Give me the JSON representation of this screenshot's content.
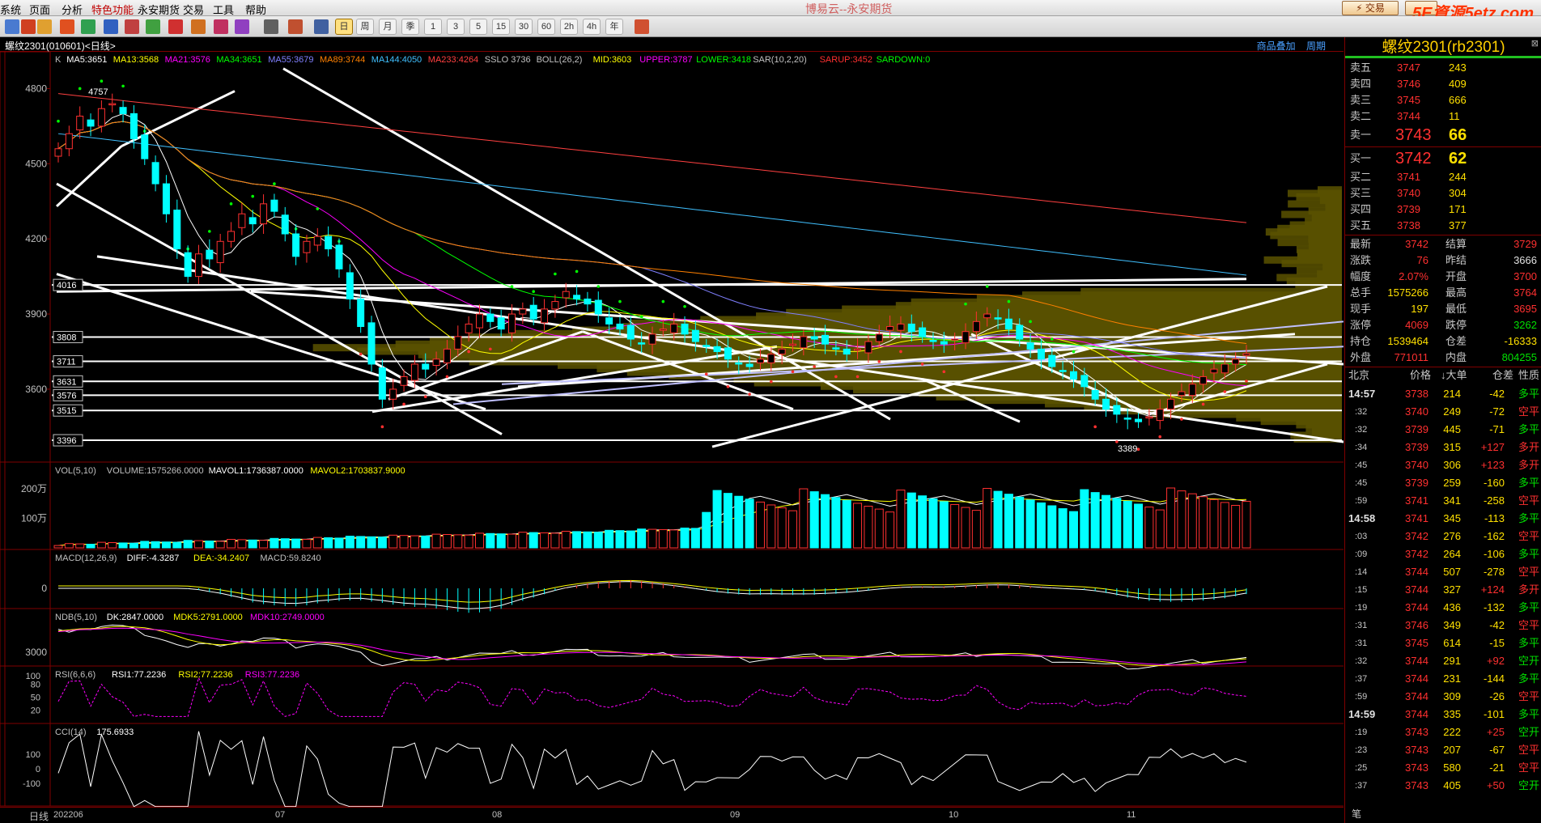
{
  "menu": {
    "items": [
      "系统",
      "页面",
      "分析",
      "特色功能",
      "永安期货",
      "交易",
      "工具",
      "帮助"
    ],
    "app_title": "博易云--永安期货",
    "trade_button": "⚡ 交易",
    "watermark": "5E資源5etz.com"
  },
  "toolbar": {
    "periods": [
      "日",
      "周",
      "月",
      "季",
      "1",
      "3",
      "5",
      "15",
      "30",
      "60",
      "2h",
      "4h",
      "年"
    ]
  },
  "chart": {
    "symbol_title": "螺纹2301(010601)<日线>",
    "link_overlay": "商品叠加",
    "link_period": "周期",
    "main_legend": [
      {
        "text": "K",
        "color": "#c0c0c0"
      },
      {
        "text": "MA5:3651",
        "color": "#ffffff"
      },
      {
        "text": "MA13:3568",
        "color": "#ffff00"
      },
      {
        "text": "MA21:3576",
        "color": "#ff00ff"
      },
      {
        "text": "MA34:3651",
        "color": "#00ff00"
      },
      {
        "text": "MA55:3679",
        "color": "#8080ff"
      },
      {
        "text": "MA89:3744",
        "color": "#ff8000"
      },
      {
        "text": "MA144:4050",
        "color": "#40c0ff"
      },
      {
        "text": "MA233:4264",
        "color": "#ff4040"
      },
      {
        "text": "SSLO 3736",
        "color": "#c0c0c0"
      },
      {
        "text": "BOLL(26,2)",
        "color": "#c0c0c0"
      },
      {
        "text": "MID:3603",
        "color": "#ffff00"
      },
      {
        "text": "UPPER:3787",
        "color": "#ff00ff"
      },
      {
        "text": "LOWER:3418",
        "color": "#00ff00"
      },
      {
        "text": "SAR(10,2,20)",
        "color": "#c0c0c0"
      },
      {
        "text": "SARUP:3452",
        "color": "#ff3030"
      },
      {
        "text": "SARDOWN:0",
        "color": "#00ff00"
      }
    ],
    "y_ticks": [
      "4800",
      "4500",
      "4200",
      "3900",
      "3600"
    ],
    "box_labels": [
      "4016",
      "3808",
      "3711",
      "3631",
      "3576",
      "3515",
      "3396"
    ],
    "peak_label": "4757",
    "low_label": "3389",
    "vol_legend": [
      {
        "text": "VOL(5,10)",
        "color": "#c0c0c0"
      },
      {
        "text": "VOLUME:1575266.0000",
        "color": "#c0c0c0"
      },
      {
        "text": "MAVOL1:1736387.0000",
        "color": "#ffffff"
      },
      {
        "text": "MAVOL2:1703837.9000",
        "color": "#ffff00"
      }
    ],
    "vol_ticks": [
      "200万",
      "100万"
    ],
    "macd_legend": [
      {
        "text": "MACD(12,26,9)",
        "color": "#c0c0c0"
      },
      {
        "text": "DIFF:-4.3287",
        "color": "#ffffff"
      },
      {
        "text": "DEA:-34.2407",
        "color": "#ffff00"
      },
      {
        "text": "MACD:59.8240",
        "color": "#c0c0c0"
      }
    ],
    "macd_ticks": [
      "0"
    ],
    "ndb_legend": [
      {
        "text": "NDB(5,10)",
        "color": "#c0c0c0"
      },
      {
        "text": "DK:2847.0000",
        "color": "#ffffff"
      },
      {
        "text": "MDK5:2791.0000",
        "color": "#ffff00"
      },
      {
        "text": "MDK10:2749.0000",
        "color": "#ff00ff"
      }
    ],
    "ndb_ticks": [
      "3000"
    ],
    "rsi_legend": [
      {
        "text": "RSI(6,6,6)",
        "color": "#c0c0c0"
      },
      {
        "text": "RSI1:77.2236",
        "color": "#ffffff"
      },
      {
        "text": "RSI2:77.2236",
        "color": "#ffff00"
      },
      {
        "text": "RSI3:77.2236",
        "color": "#ff00ff"
      }
    ],
    "rsi_ticks": [
      "100",
      "80",
      "50",
      "20"
    ],
    "cci_legend": [
      {
        "text": "CCI(14)",
        "color": "#c0c0c0"
      },
      {
        "text": "175.6933",
        "color": "#ffffff"
      }
    ],
    "cci_ticks": [
      "100",
      "0",
      "-100"
    ],
    "x_period_label": "日线",
    "x_labels": [
      "202206",
      "07",
      "08",
      "09",
      "10",
      "11"
    ]
  },
  "quote": {
    "title": "螺纹2301(rb2301)",
    "asks": [
      {
        "label": "卖五",
        "price": "3747",
        "vol": "243"
      },
      {
        "label": "卖四",
        "price": "3746",
        "vol": "409"
      },
      {
        "label": "卖三",
        "price": "3745",
        "vol": "666"
      },
      {
        "label": "卖二",
        "price": "3744",
        "vol": "11"
      },
      {
        "label": "卖一",
        "price": "3743",
        "vol": "66"
      }
    ],
    "bids": [
      {
        "label": "买一",
        "price": "3742",
        "vol": "62"
      },
      {
        "label": "买二",
        "price": "3741",
        "vol": "244"
      },
      {
        "label": "买三",
        "price": "3740",
        "vol": "304"
      },
      {
        "label": "买四",
        "price": "3739",
        "vol": "171"
      },
      {
        "label": "买五",
        "price": "3738",
        "vol": "377"
      }
    ],
    "stats": [
      {
        "l1": "最新",
        "v1": "3742",
        "c1": "red",
        "l2": "结算",
        "v2": "3729",
        "c2": "red"
      },
      {
        "l1": "涨跌",
        "v1": "76",
        "c1": "red",
        "l2": "昨结",
        "v2": "3666",
        "c2": "wht"
      },
      {
        "l1": "幅度",
        "v1": "2.07%",
        "c1": "red",
        "l2": "开盘",
        "v2": "3700",
        "c2": "red"
      },
      {
        "l1": "总手",
        "v1": "1575266",
        "c1": "yel",
        "l2": "最高",
        "v2": "3764",
        "c2": "red"
      },
      {
        "l1": "现手",
        "v1": "197",
        "c1": "yel",
        "l2": "最低",
        "v2": "3695",
        "c2": "red"
      },
      {
        "l1": "涨停",
        "v1": "4069",
        "c1": "red",
        "l2": "跌停",
        "v2": "3262",
        "c2": "grn"
      },
      {
        "l1": "持仓",
        "v1": "1539464",
        "c1": "yel",
        "l2": "仓差",
        "v2": "-16333",
        "c2": "yel"
      },
      {
        "l1": "外盘",
        "v1": "771011",
        "c1": "red",
        "l2": "内盘",
        "v2": "804255",
        "c2": "grn"
      }
    ],
    "tick_headers": [
      "北京",
      "价格",
      "↓大单",
      "仓差",
      "性质"
    ],
    "ticks": [
      {
        "t": "14:57",
        "p": "3738",
        "v": "214",
        "d": "-42",
        "k": "多平",
        "pc": "red",
        "kc": "grn"
      },
      {
        "t": ":32",
        "p": "3740",
        "v": "249",
        "d": "-72",
        "k": "空平",
        "pc": "red",
        "kc": "red"
      },
      {
        "t": ":32",
        "p": "3739",
        "v": "445",
        "d": "-71",
        "k": "多平",
        "pc": "red",
        "kc": "grn"
      },
      {
        "t": ":34",
        "p": "3739",
        "v": "315",
        "d": "+127",
        "k": "多开",
        "pc": "red",
        "kc": "red"
      },
      {
        "t": ":45",
        "p": "3740",
        "v": "306",
        "d": "+123",
        "k": "多开",
        "pc": "red",
        "kc": "red"
      },
      {
        "t": ":45",
        "p": "3739",
        "v": "259",
        "d": "-160",
        "k": "多平",
        "pc": "red",
        "kc": "grn"
      },
      {
        "t": ":59",
        "p": "3741",
        "v": "341",
        "d": "-258",
        "k": "空平",
        "pc": "red",
        "kc": "red"
      },
      {
        "t": "14:58",
        "p": "3741",
        "v": "345",
        "d": "-113",
        "k": "多平",
        "pc": "red",
        "kc": "grn"
      },
      {
        "t": ":03",
        "p": "3742",
        "v": "276",
        "d": "-162",
        "k": "空平",
        "pc": "red",
        "kc": "red"
      },
      {
        "t": ":09",
        "p": "3742",
        "v": "264",
        "d": "-106",
        "k": "多平",
        "pc": "red",
        "kc": "grn"
      },
      {
        "t": ":14",
        "p": "3744",
        "v": "507",
        "d": "-278",
        "k": "空平",
        "pc": "red",
        "kc": "red"
      },
      {
        "t": ":15",
        "p": "3744",
        "v": "327",
        "d": "+124",
        "k": "多开",
        "pc": "red",
        "kc": "red"
      },
      {
        "t": ":19",
        "p": "3744",
        "v": "436",
        "d": "-132",
        "k": "多平",
        "pc": "red",
        "kc": "grn"
      },
      {
        "t": ":31",
        "p": "3746",
        "v": "349",
        "d": "-42",
        "k": "空平",
        "pc": "red",
        "kc": "red"
      },
      {
        "t": ":31",
        "p": "3745",
        "v": "614",
        "d": "-15",
        "k": "多平",
        "pc": "red",
        "kc": "grn"
      },
      {
        "t": ":32",
        "p": "3744",
        "v": "291",
        "d": "+92",
        "k": "空开",
        "pc": "red",
        "kc": "grn"
      },
      {
        "t": ":37",
        "p": "3744",
        "v": "231",
        "d": "-144",
        "k": "多平",
        "pc": "red",
        "kc": "grn"
      },
      {
        "t": ":59",
        "p": "3744",
        "v": "309",
        "d": "-26",
        "k": "空平",
        "pc": "red",
        "kc": "red"
      },
      {
        "t": "14:59",
        "p": "3744",
        "v": "335",
        "d": "-101",
        "k": "多平",
        "pc": "red",
        "kc": "grn"
      },
      {
        "t": ":19",
        "p": "3743",
        "v": "222",
        "d": "+25",
        "k": "空开",
        "pc": "red",
        "kc": "grn"
      },
      {
        "t": ":23",
        "p": "3743",
        "v": "207",
        "d": "-67",
        "k": "空平",
        "pc": "red",
        "kc": "red"
      },
      {
        "t": ":25",
        "p": "3743",
        "v": "580",
        "d": "-21",
        "k": "空平",
        "pc": "red",
        "kc": "red"
      },
      {
        "t": ":37",
        "p": "3743",
        "v": "405",
        "d": "+50",
        "k": "空开",
        "pc": "red",
        "kc": "grn"
      }
    ],
    "bottom_tab": "笔"
  },
  "chart_data": {
    "type": "candlestick",
    "title": "螺纹2301(010601)<日线>",
    "x_range": [
      "202206",
      "11"
    ],
    "ylim": [
      3389,
      4800
    ],
    "close_series": [
      4560,
      4620,
      4690,
      4650,
      4720,
      4740,
      4700,
      4600,
      4520,
      4420,
      4300,
      4160,
      4050,
      4140,
      4120,
      4190,
      4230,
      4300,
      4260,
      4340,
      4310,
      4220,
      4130,
      4190,
      4210,
      4160,
      4080,
      3960,
      3850,
      3700,
      3560,
      3600,
      3650,
      3700,
      3680,
      3720,
      3760,
      3810,
      3860,
      3900,
      3870,
      3840,
      3900,
      3920,
      3880,
      3920,
      3950,
      3990,
      3960,
      3940,
      3900,
      3860,
      3840,
      3800,
      3780,
      3820,
      3840,
      3860,
      3820,
      3790,
      3770,
      3750,
      3720,
      3700,
      3690,
      3720,
      3740,
      3760,
      3780,
      3810,
      3800,
      3780,
      3760,
      3740,
      3760,
      3790,
      3820,
      3850,
      3860,
      3830,
      3810,
      3790,
      3780,
      3800,
      3830,
      3870,
      3900,
      3880,
      3840,
      3800,
      3760,
      3720,
      3690,
      3670,
      3640,
      3610,
      3560,
      3520,
      3500,
      3480,
      3470,
      3490,
      3520,
      3560,
      3590,
      3620,
      3650,
      3680,
      3700,
      3720,
      3742
    ],
    "last_close": 3742,
    "volume_last": 1575266
  }
}
